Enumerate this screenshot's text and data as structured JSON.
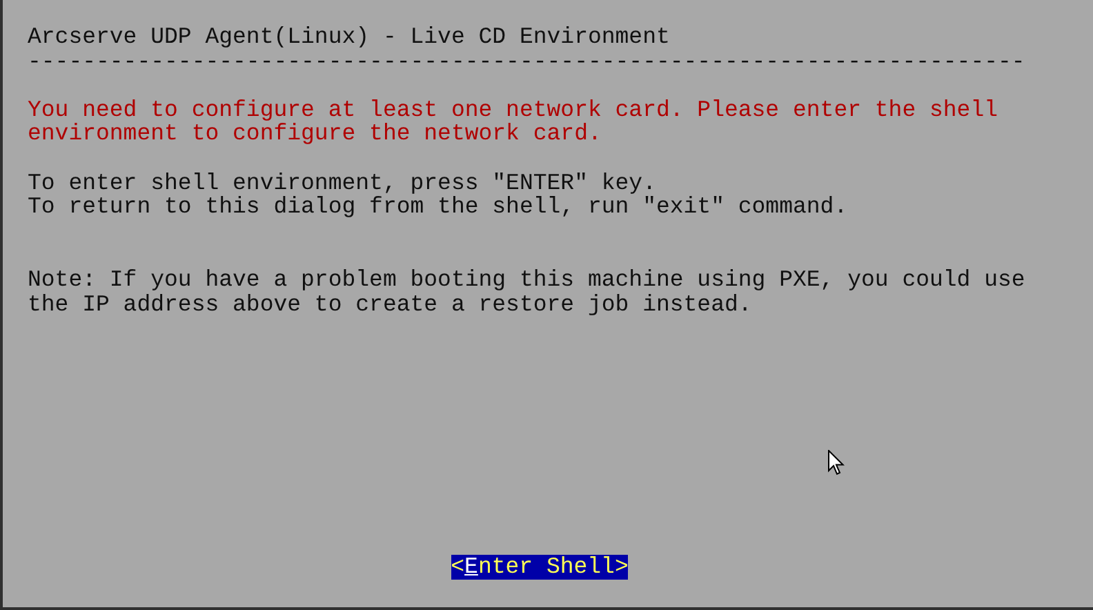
{
  "title": "Arcserve UDP Agent(Linux) - Live CD Environment",
  "separator": "-------------------------------------------------------------------------",
  "paragraphs": [
    {
      "kind": "error",
      "lines": [
        "You need to configure at least one network card. Please enter the shell",
        "environment to configure the network card."
      ]
    },
    {
      "kind": "info",
      "lines": [
        "To enter shell environment, press \"ENTER\" key.",
        "To return to this dialog from the shell, run \"exit\" command."
      ]
    },
    {
      "kind": "note",
      "lines": [
        "Note: If you have a problem booting this machine using PXE, you could use",
        "the IP address above to create a restore job instead."
      ]
    }
  ],
  "button": {
    "label": "<Enter Shell>",
    "focused": true
  }
}
